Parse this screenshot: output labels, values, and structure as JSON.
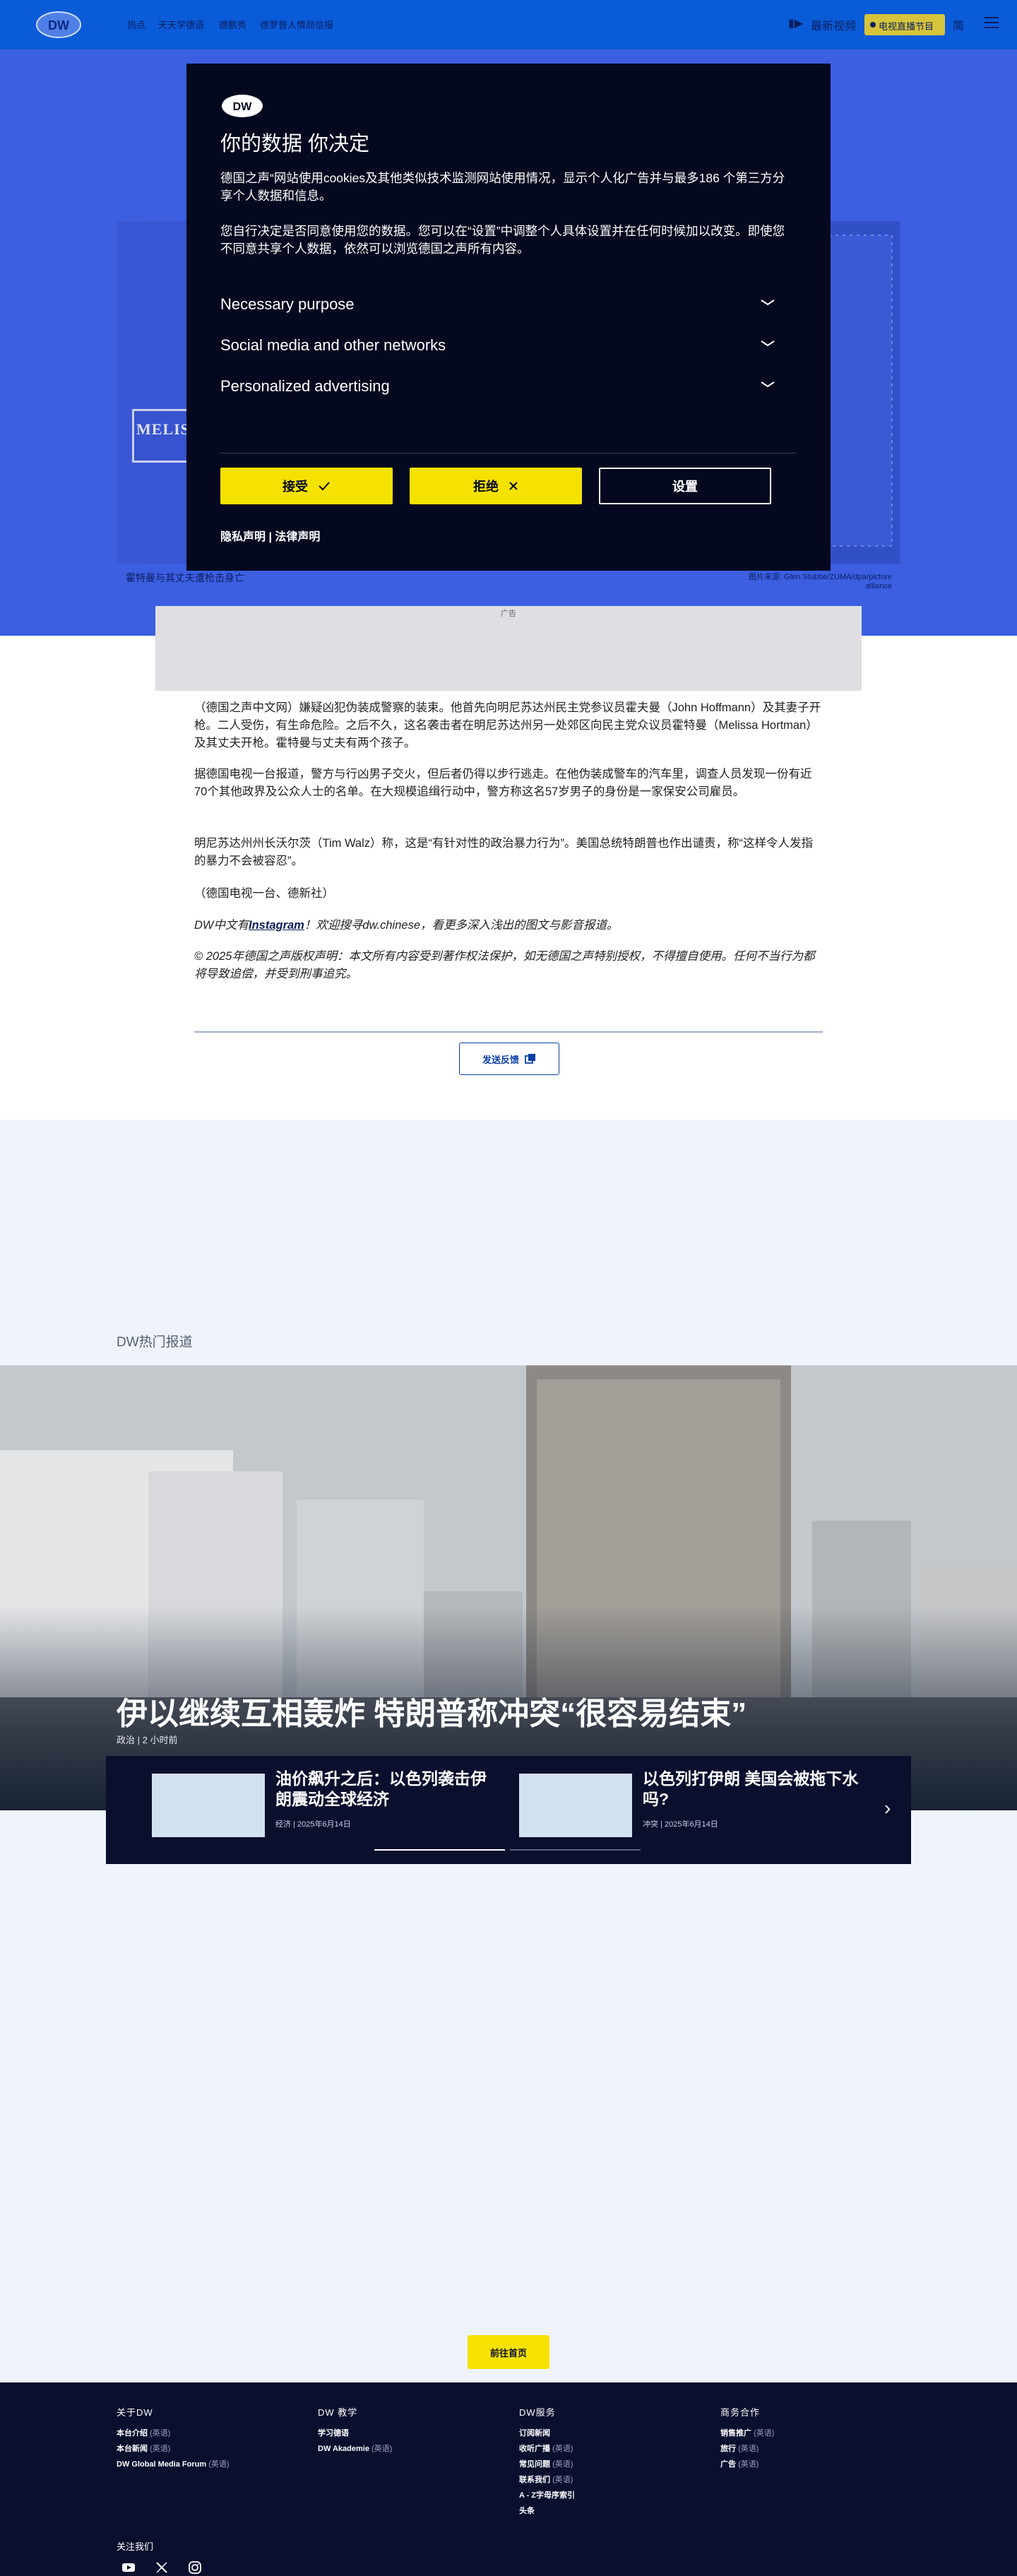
{
  "header": {
    "logo": "DW",
    "nav": [
      "热点",
      "天天学德语",
      "德鹏秀",
      "德罗普人情局信报"
    ],
    "live_label": "最新视频",
    "program_pill": "电视直播节目",
    "lang_label": "简"
  },
  "hero": {
    "sign_text": "MELIS",
    "caption": "霍特曼与其丈夫遭枪击身亡",
    "credit": "图片来源: Glen Stubbe/ZUMA/dpa/picture alliance"
  },
  "ad": {
    "label": "广告"
  },
  "article": {
    "paragraphs": [
      "（德国之声中文网）嫌疑凶犯伪装成警察的装束。他首先向明尼苏达州民主党参议员霍夫曼（John Hoffmann）及其妻子开枪。二人受伤，有生命危险。之后不久，这名袭击者在明尼苏达州另一处郊区向民主党众议员霍特曼（Melissa Hortman）及其丈夫开枪。霍特曼与丈夫有两个孩子。",
      "据德国电视一台报道，警方与行凶男子交火，但后者仍得以步行逃走。在他伪装成警车的汽车里，调查人员发现一份有近70个其他政界及公众人士的名单。在大规模追缉行动中，警方称这名57岁男子的身份是一家保安公司雇员。",
      "明尼苏达州州长沃尔茨（Tim Walz）称，这是“有针对性的政治暴力行为”。美国总统特朗普也作出谴责，称“这样令人发指的暴力不会被容忍”。",
      "（德国电视一台、德新社）"
    ],
    "follow_prefix": "DW中文有",
    "follow_link": "Instagram",
    "follow_suffix": "！欢迎搜寻dw.chinese，看更多深入浅出的图文与影音报道。",
    "copyright": "© 2025年德国之声版权声明：本文所有内容受到著作权法保护，如无德国之声特别授权，不得擅自使用。任何不当行为都将导致追偿，并受到刑事追究。",
    "feedback_label": "发送反馈"
  },
  "hot": {
    "heading": "DW热门报道",
    "title": "伊以继续互相轰炸 特朗普称冲突“很容易结束”",
    "meta": "政治 | 2 小时前",
    "related": [
      {
        "title": "油价飙升之后：以色列袭击伊朗震动全球经济",
        "meta": "经济 | 2025年6月14日"
      },
      {
        "title": "以色列打伊朗 美国会被拖下水吗?",
        "meta": "冲突 | 2025年6月14日"
      }
    ],
    "next_label": "›"
  },
  "home_button": "前往首页",
  "footer": {
    "columns": [
      {
        "head": "关于DW",
        "items": [
          {
            "label": "本台介绍",
            "lang": "(英语)"
          },
          {
            "label": "本台新闻",
            "lang": "(英语)"
          },
          {
            "label": "DW Global Media Forum",
            "lang": "(英语)"
          }
        ]
      },
      {
        "head": "DW 教学",
        "items": [
          {
            "label": "学习德语",
            "lang": ""
          },
          {
            "label": "DW Akademie",
            "lang": "(英语)"
          }
        ]
      },
      {
        "head": "DW服务",
        "items": [
          {
            "label": "订阅新闻",
            "lang": ""
          },
          {
            "label": "收听广播",
            "lang": "(英语)"
          },
          {
            "label": "常见问题",
            "lang": "(英语)"
          },
          {
            "label": "联系我们",
            "lang": "(英语)"
          },
          {
            "label": "A - Z字母序索引",
            "lang": ""
          },
          {
            "label": "头条",
            "lang": ""
          }
        ]
      },
      {
        "head": "商务合作",
        "items": [
          {
            "label": "销售推广",
            "lang": "(英语)"
          },
          {
            "label": "旅行",
            "lang": "(英语)"
          },
          {
            "label": "广告",
            "lang": "(英语)"
          }
        ]
      }
    ],
    "follow_label": "关注我们",
    "social": [
      "youtube-icon",
      "x-icon",
      "instagram-icon"
    ]
  },
  "consent": {
    "title": "你的数据 你决定",
    "p1": "德国之声“网站使用cookies及其他类似技术监测网站使用情况，显示个人化广告并与最多186 个第三方分享个人数据和信息。",
    "p2": "您自行决定是否同意使用您的数据。您可以在“设置”中调整个人具体设置并在任何时候加以改变。即使您不同意共享个人数据，依然可以浏览德国之声所有内容。",
    "purposes": [
      "Necessary purpose",
      "Social media and other networks",
      "Personalized advertising"
    ],
    "accept": "接受",
    "reject": "拒绝",
    "settings": "设置",
    "privacy": "隐私声明",
    "legal": "法律声明"
  },
  "colors": {
    "brand_blue": "#0a5bd8",
    "dark_navy": "#05091f",
    "accent_yellow": "#f6e200"
  }
}
